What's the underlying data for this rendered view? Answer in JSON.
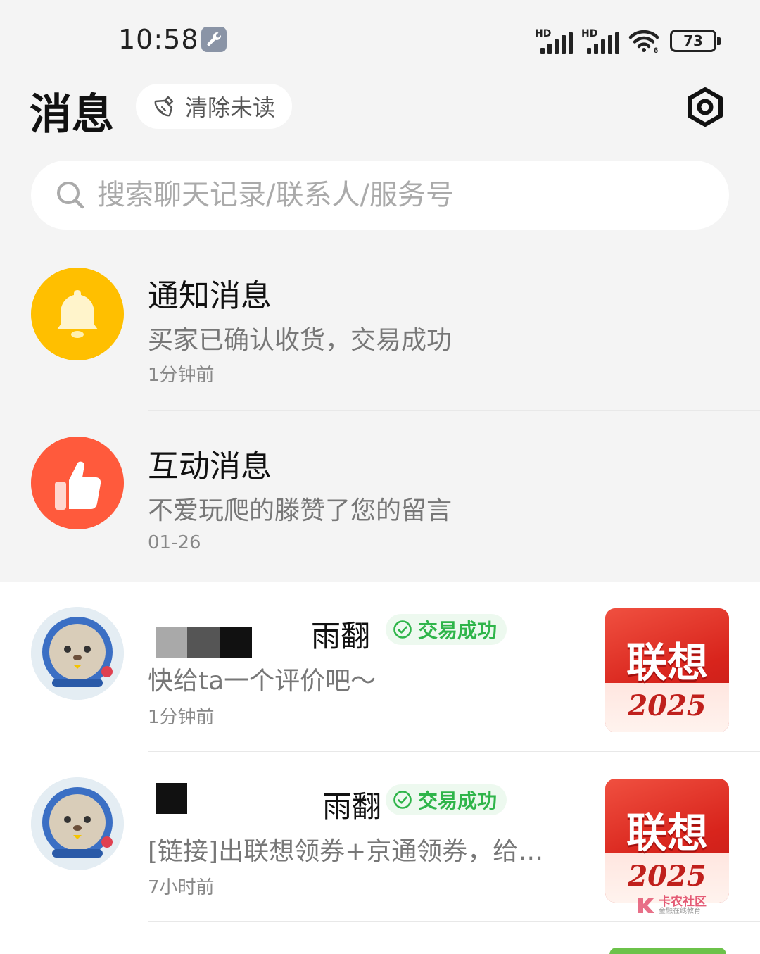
{
  "status_bar": {
    "time": "10:58",
    "signal1_label": "HD",
    "signal2_label": "HD",
    "wifi_label": "6",
    "battery": "73"
  },
  "header": {
    "title": "消息",
    "clear_unread": "清除未读"
  },
  "search": {
    "placeholder": "搜索聊天记录/联系人/服务号"
  },
  "system_messages": [
    {
      "title": "通知消息",
      "preview": "买家已确认收货，交易成功",
      "time": "1分钟前",
      "icon": "bell-icon",
      "color": "#ffc107"
    },
    {
      "title": "互动消息",
      "preview": "不爱玩爬的滕赞了您的留言",
      "time": "01-26",
      "icon": "thumbs-up-icon",
      "color": "#ff5a3c"
    }
  ],
  "chats": [
    {
      "name_tail": "雨翻",
      "badge": "交易成功",
      "preview": "快给ta一个评价吧～",
      "time": "1分钟前",
      "thumb_title": "联想",
      "thumb_year": "2025"
    },
    {
      "name_tail": "雨翻",
      "badge": "交易成功",
      "preview": "[链接]出联想领券+京通领券，给…",
      "time": "7小时前",
      "thumb_title": "联想",
      "thumb_year": "2025"
    }
  ],
  "watermark": {
    "title": "卡农社区",
    "subtitle": "金融在线教育"
  },
  "colors": {
    "badge_green": "#2fb54a",
    "badge_bg": "#edf9ef",
    "page_bg": "#f4f4f4"
  }
}
